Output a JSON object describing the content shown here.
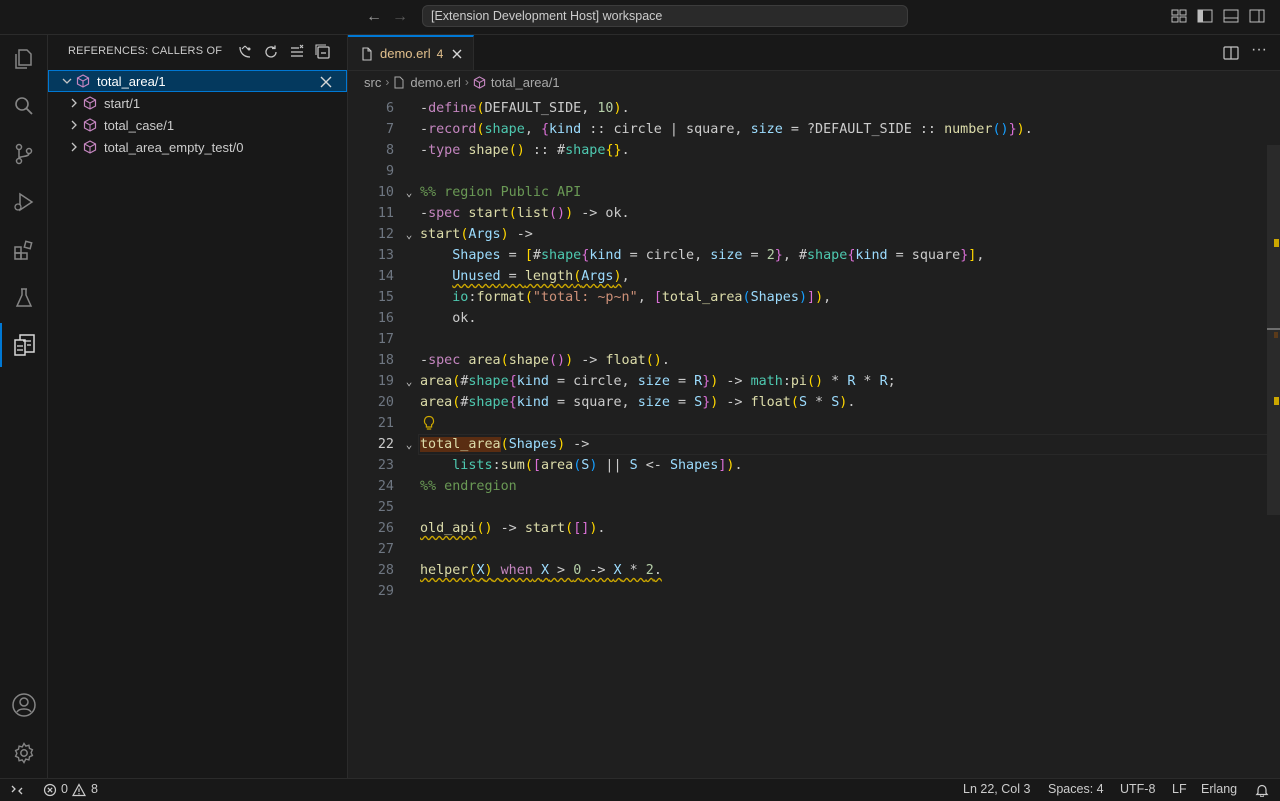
{
  "titlebar": {
    "search_text": "[Extension Development Host] workspace",
    "back_icon": "arrow-left-icon",
    "forward_icon": "arrow-right-icon"
  },
  "activity_bar": {
    "items": [
      "explorer",
      "search",
      "source-control",
      "run-and-debug",
      "extensions",
      "testing",
      "references"
    ],
    "bottom": [
      "accounts",
      "manage"
    ]
  },
  "sidebar": {
    "title": "REFERENCES: CALLERS OF",
    "tree": {
      "root": "total_area/1",
      "children": [
        "start/1",
        "total_case/1",
        "total_area_empty_test/0"
      ]
    }
  },
  "editor": {
    "tab": {
      "label": "demo.erl",
      "problems": "4"
    },
    "breadcrumbs": [
      "src",
      "demo.erl",
      "total_area/1"
    ],
    "current_line": 22,
    "line_numbers": [
      "6",
      "7",
      "8",
      "9",
      "10",
      "11",
      "12",
      "13",
      "14",
      "15",
      "16",
      "17",
      "18",
      "19",
      "20",
      "21",
      "22",
      "23",
      "24",
      "25",
      "26",
      "27",
      "28",
      "29"
    ]
  },
  "statusbar": {
    "errors": "0",
    "warnings": "8",
    "position": "Ln 22, Col 3",
    "spaces": "Spaces: 4",
    "encoding": "UTF-8",
    "eol": "LF",
    "language": "Erlang"
  },
  "colors": {
    "accent": "#0078d4",
    "modified_tab": "#e2c08d",
    "warning": "#cca700"
  }
}
